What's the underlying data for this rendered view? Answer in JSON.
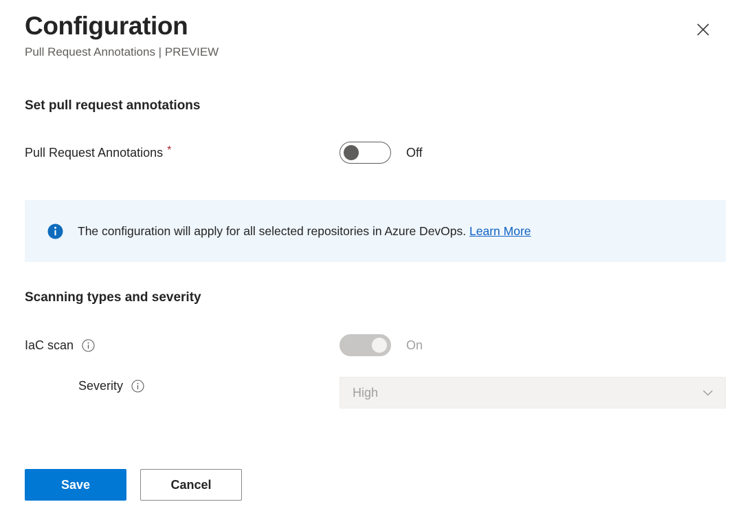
{
  "header": {
    "title": "Configuration",
    "subtitle": "Pull Request Annotations | PREVIEW",
    "close_label": "Close",
    "close_icon": "close-icon"
  },
  "sections": {
    "set_pr_annotations": {
      "heading": "Set pull request annotations",
      "pull_request_annotations": {
        "label": "Pull Request Annotations",
        "required_marker": "*",
        "toggle_state": "Off",
        "toggle_value": "off",
        "enabled": true
      }
    },
    "scanning": {
      "heading": "Scanning types and severity",
      "iac_scan": {
        "label": "IaC scan",
        "info_icon": "info-circle-outline-icon",
        "toggle_state": "On",
        "toggle_value": "on",
        "enabled": false
      },
      "severity": {
        "label": "Severity",
        "info_icon": "info-circle-outline-icon",
        "selected": "High",
        "options": [
          "High"
        ],
        "enabled": false,
        "chevron_icon": "chevron-down-icon"
      }
    }
  },
  "banner": {
    "icon": "info-filled-icon",
    "text": "The configuration will apply for all selected repositories in Azure DevOps.",
    "link_text": "Learn More"
  },
  "footer": {
    "save_label": "Save",
    "cancel_label": "Cancel"
  },
  "colors": {
    "primary": "#0078D4",
    "banner_bg": "#EFF6FC",
    "info_blue": "#0F6CBD",
    "link": "#0F62C4",
    "required_red": "#A4262C",
    "disabled_text": "#A19F9D",
    "subtitle_gray": "#605E5C"
  }
}
